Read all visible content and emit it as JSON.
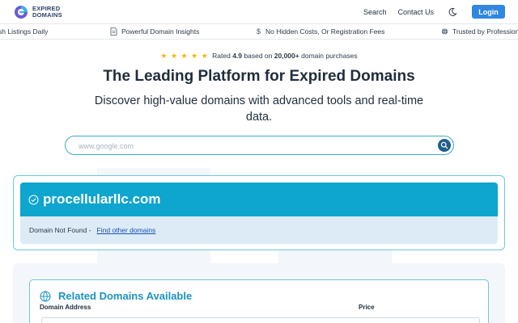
{
  "header": {
    "logo_line1": "EXPIRED",
    "logo_line2": "DOMAINS",
    "nav": {
      "search": "Search",
      "contact": "Contact Us",
      "login": "Login"
    }
  },
  "ticker": [
    {
      "text": "sh Listings Daily",
      "icon": "none"
    },
    {
      "text": "Powerful Domain Insights",
      "icon": "document-icon"
    },
    {
      "text": "No Hidden Costs, Or Registration Fees",
      "icon": "dollar-icon"
    },
    {
      "text": "Trusted by Professiona",
      "icon": "globe-icon"
    }
  ],
  "rating": {
    "stars": "★ ★ ★ ★ ★",
    "prefix": "Rated",
    "score": "4.9",
    "middle": "based on",
    "count": "20,000+",
    "suffix": "domain purchases"
  },
  "hero": {
    "headline": "The Leading Platform for Expired Domains",
    "subhead": "Discover high-value domains with advanced tools and real-time data."
  },
  "search": {
    "placeholder": "www.google.com",
    "value": ""
  },
  "result": {
    "domain": "procellularllc.com",
    "status": "Domain Not Found -",
    "link": "Find other domains"
  },
  "related": {
    "title": "Related Domains Available",
    "columns": [
      "Domain Address",
      "Price"
    ]
  },
  "colors": {
    "accent": "#2f87e0",
    "teal": "#0ea5cf",
    "star": "#f5b400",
    "link": "#1a4fb5"
  }
}
